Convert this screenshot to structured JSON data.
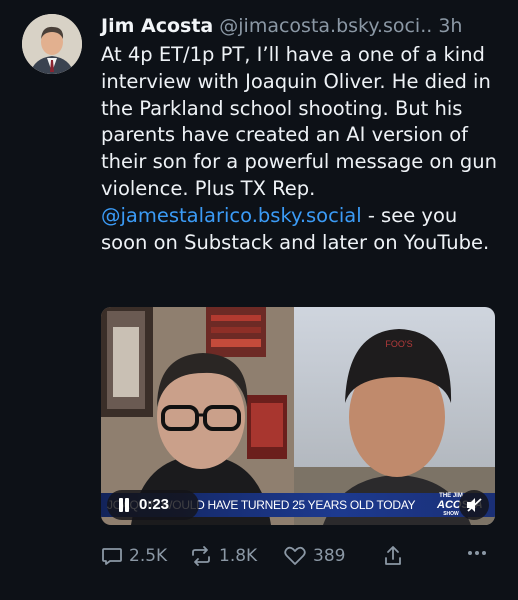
{
  "post": {
    "author_name": "Jim Acosta",
    "author_handle": "@jimacosta.bsky.soci..",
    "timestamp": "3h",
    "text_before_mention": "At 4p ET/1p PT, I’ll have a one of a kind interview with Joaquin Oliver. He died in the Parkland school shooting. But his parents have created an AI version of their son for a powerful message on gun violence. Plus TX Rep. ",
    "mention": "@jamestalarico.bsky.social",
    "text_after_mention": " - see you soon on Substack and later on YouTube."
  },
  "video": {
    "ticker_text": "JOAQUIN WOULD HAVE TURNED 25 YEARS OLD TODAY",
    "elapsed_time": "0:23",
    "logo_line1": "THE JIM",
    "logo_line2": "ACOSTA",
    "logo_line3": "SHOW",
    "hat_text": "FOO'S"
  },
  "actions": {
    "replies": "2.5K",
    "reposts": "1.8K",
    "likes": "389"
  },
  "colors": {
    "background": "#0d1117",
    "mention": "#3b9bf6",
    "muted": "#8b98a5"
  }
}
